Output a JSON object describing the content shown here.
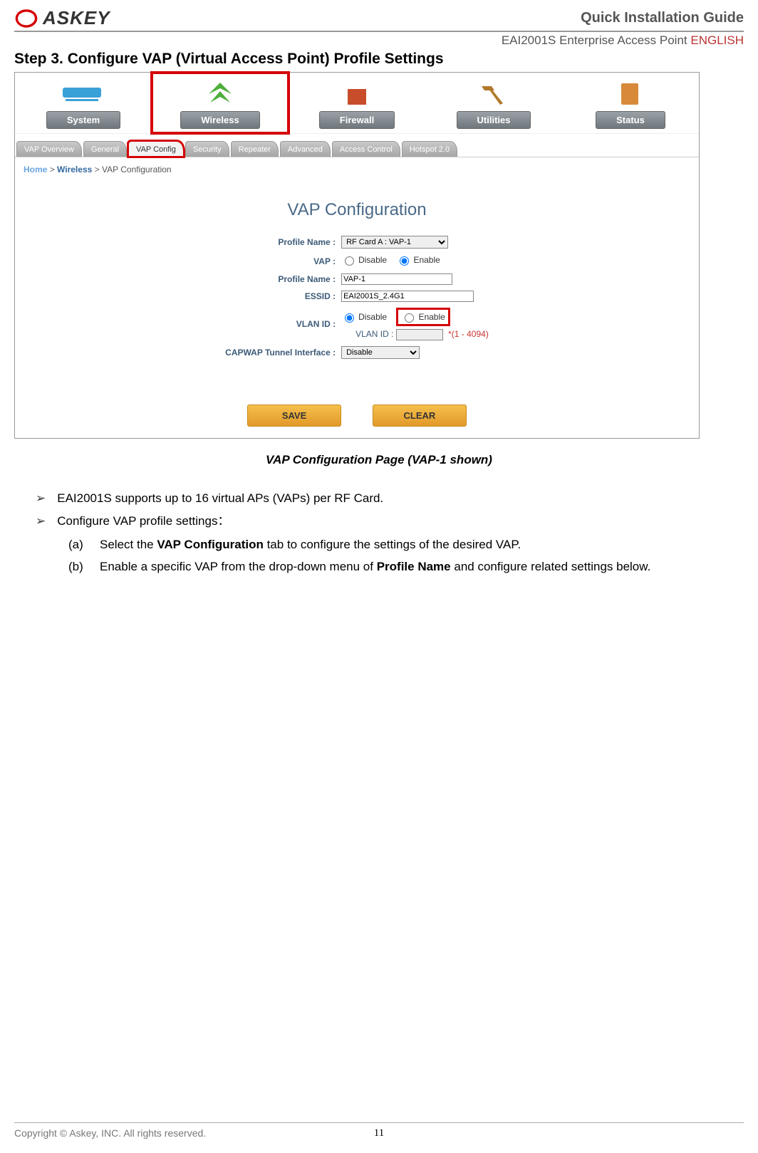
{
  "header": {
    "brand": "ASKEY",
    "guide": "Quick Installation Guide",
    "product": "EAI2001S Enterprise Access Point",
    "language": "ENGLISH"
  },
  "step_title": "Step 3. Configure VAP (Virtual Access Point) Profile Settings",
  "main_nav": {
    "system": "System",
    "wireless": "Wireless",
    "firewall": "Firewall",
    "utilities": "Utilities",
    "status": "Status"
  },
  "subtabs": {
    "overview": "VAP Overview",
    "general": "General",
    "vapconfig": "VAP Config",
    "security": "Security",
    "repeater": "Repeater",
    "advanced": "Advanced",
    "accesscontrol": "Access Control",
    "hotspot": "Hotspot 2.0"
  },
  "breadcrumb": {
    "home": "Home",
    "section": "Wireless",
    "page": "VAP Configuration"
  },
  "panel": {
    "title": "VAP Configuration",
    "labels": {
      "profile_select": "Profile Name :",
      "vap": "VAP :",
      "profile_name": "Profile Name :",
      "essid": "ESSID :",
      "vlan_id": "VLAN ID :",
      "vlan_sub": "VLAN ID :",
      "capwap": "CAPWAP Tunnel Interface :"
    },
    "values": {
      "profile_select": "RF Card A : VAP-1",
      "disable": "Disable",
      "enable": "Enable",
      "profile_name": "VAP-1",
      "essid": "EAI2001S_2.4G1",
      "vlan_hint": "*(1 - 4094)",
      "capwap": "Disable"
    },
    "buttons": {
      "save": "SAVE",
      "clear": "CLEAR"
    }
  },
  "caption": "VAP Configuration Page (VAP-1 shown)",
  "bullets": {
    "b1": "EAI2001S supports up to 16 virtual APs (VAPs) per RF Card.",
    "b2": "Configure VAP profile settings：",
    "a_pre": "Select the ",
    "a_bold": "VAP Configuration",
    "a_post": " tab to configure the settings of the desired VAP.",
    "b_pre": "Enable a specific VAP from the drop-down menu of ",
    "b_bold": "Profile Name",
    "b_post": " and configure related settings below."
  },
  "footer": {
    "copyright": "Copyright © Askey, INC. All rights reserved.",
    "page": "11"
  }
}
